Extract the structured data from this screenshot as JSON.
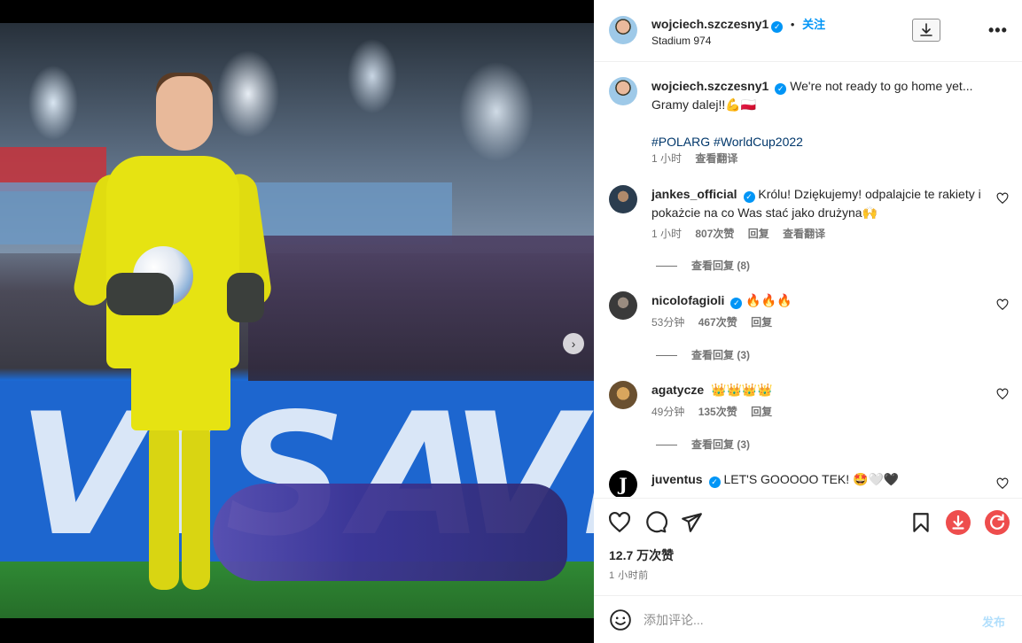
{
  "post": {
    "username": "wojciech.szczesny1",
    "separator": "•",
    "follow_label": "关注",
    "location": "Stadium 974",
    "more_label": "•••"
  },
  "media": {
    "ad_text_left": "VISA",
    "ad_text_right": "VIS",
    "next_icon": "›",
    "slide_count": 4,
    "active_slide": 1
  },
  "caption": {
    "username": "wojciech.szczesny1",
    "text_line1": "We're not ready to go home yet...",
    "text_line2": "Gramy dalej!!💪🇵🇱",
    "hashtags": "#POLARG #WorldCup2022",
    "time": "1 小时",
    "translate": "查看翻译"
  },
  "comments": [
    {
      "username": "jankes_official",
      "text": "Królu! Dziękujemy! odpalajcie te rakiety i pokażcie na co Was stać jako drużyna🙌",
      "time": "1 小时",
      "likes": "807次赞",
      "reply": "回复",
      "translate": "查看翻译",
      "view_replies": "查看回复 (8)"
    },
    {
      "username": "nicolofagioli",
      "text": "🔥🔥🔥",
      "time": "53分钟",
      "likes": "467次赞",
      "reply": "回复",
      "view_replies": "查看回复 (3)"
    },
    {
      "username": "agatycze",
      "text": "👑👑👑👑",
      "time": "49分钟",
      "likes": "135次赞",
      "reply": "回复",
      "view_replies": "查看回复 (3)"
    },
    {
      "username": "juventus",
      "avatar_text": "J",
      "text": "LET'S GOOOOO TEK! 🤩🤍🖤"
    }
  ],
  "actions": {
    "likes": "12.7 万次赞",
    "time": "1 小时前"
  },
  "composer": {
    "placeholder": "添加评论...",
    "post_label": "发布"
  },
  "colors": {
    "accent": "#0095f6",
    "link": "#00376b",
    "secondary_text": "#737373",
    "extension_red": "#ee4d4d"
  }
}
